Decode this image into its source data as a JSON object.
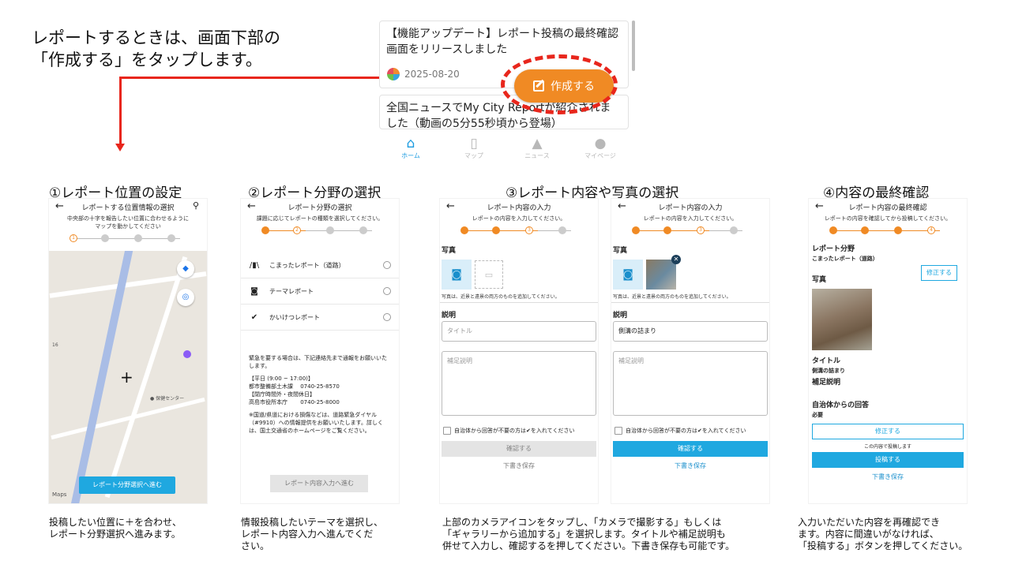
{
  "intro": {
    "line1": "レポートするときは、画面下部の",
    "line2": "「作成する」をタップします。"
  },
  "news": {
    "card1_title": "【機能アップデート】レポート投稿の最終確認画面をリリースしました",
    "card1_date": "2025-08-20",
    "card2_title": "全国ニュースでMy City Reportが紹介されました（動画の5分55秒頃から登場）",
    "fab_label": "作成する"
  },
  "bottom_nav": [
    {
      "label": "ホーム",
      "icon": "home-icon"
    },
    {
      "label": "マップ",
      "icon": "map-icon"
    },
    {
      "label": "ニュース",
      "icon": "bell-icon"
    },
    {
      "label": "マイページ",
      "icon": "person-icon"
    }
  ],
  "steps": {
    "s1": "①レポート位置の設定",
    "s2": "②レポート分野の選択",
    "s3": "③レポート内容や写真の選択",
    "s4": "④内容の最終確認"
  },
  "phone1": {
    "title": "レポートする位置情報の選択",
    "sub1": "中央部の十字を報告したい位置に合わせるように",
    "sub2": "マップを動かしてください",
    "map_place": "保健センター",
    "map_number": "16",
    "go_button": "レポート分野選択へ進む",
    "maps_label": "Maps"
  },
  "phone2": {
    "title": "レポート分野の選択",
    "sub": "課題に応じてレポートの種類を選択してください。",
    "categories": [
      "こまったレポート（道路）",
      "テーマレポート",
      "かいけつレポート"
    ],
    "note1": "緊急を要する場合は、下記連絡先まで通報をお願いいたします。",
    "note2a": "【平日 (9:00 ~ 17:00)】",
    "note2b": "都市整備部土木課　 0740-25-8570",
    "note2c": "【閉庁時間外・夜間休日】",
    "note2d": "高島市役所本庁　　 0740-25-8000",
    "note3": "※国道/県道における損傷などは、道路緊急ダイヤル（#9910）への情報提供をお願いいたします。詳しくは、国土交通省のホームページをご覧ください。",
    "next_button": "レポート内容入力へ進む"
  },
  "phone3": {
    "title": "レポート内容の入力",
    "sub": "レポートの内容を入力してください。",
    "photo_label": "写真",
    "photo_note": "写真は、近景と遠景の両方のものを追加してください。",
    "desc_label": "説明",
    "title_placeholder": "タイトル",
    "detail_placeholder": "補足説明",
    "check_label": "自治体から回答が不要の方は✔を入れてください",
    "confirm": "確認する",
    "draft": "下書き保存"
  },
  "phone4": {
    "title": "レポート内容の入力",
    "sub": "レポートの内容を入力してください。",
    "photo_label": "写真",
    "photo_note": "写真は、近景と遠景の両方のものを追加してください。",
    "desc_label": "説明",
    "title_value": "側溝の詰まり",
    "detail_placeholder": "補足説明",
    "check_label": "自治体から回答が不要の方は✔を入れてください",
    "confirm": "確認する",
    "draft": "下書き保存"
  },
  "phone5": {
    "title": "レポート内容の最終確認",
    "sub": "レポートの内容を確認してから投稿してください。",
    "category_label": "レポート分野",
    "category_value": "こまったレポート（道路）",
    "fix": "修正する",
    "photo_label": "写真",
    "title_label": "タイトル",
    "title_value": "側溝の詰まり",
    "detail_label": "補足説明",
    "answer_label": "自治体からの回答",
    "answer_value": "必要",
    "fix2": "修正する",
    "post_note": "この内容で投稿します",
    "post": "投稿する",
    "draft": "下書き保存"
  },
  "captions": {
    "c1a": "投稿したい位置に＋を合わせ、",
    "c1b": "レポート分野選択へ進みます。",
    "c2a": "情報投稿したいテーマを選択し、",
    "c2b": "レポート内容入力へ進んでくだ",
    "c2c": "さい。",
    "c3a": "上部のカメラアイコンをタップし、「カメラで撮影する」もしくは",
    "c3b": "「ギャラリーから追加する」を選択します。タイトルや補足説明も",
    "c3c": "併せて入力し、確認するを押してください。下書き保存も可能です。",
    "c4a": "入力いただいた内容を再確認でき",
    "c4b": "ます。内容に間違いがなければ、",
    "c4c": "「投稿する」ボタンを押してください。"
  },
  "colors": {
    "accent": "#f08a24",
    "primary": "#1fa8e0",
    "annotation": "#e8261c"
  }
}
